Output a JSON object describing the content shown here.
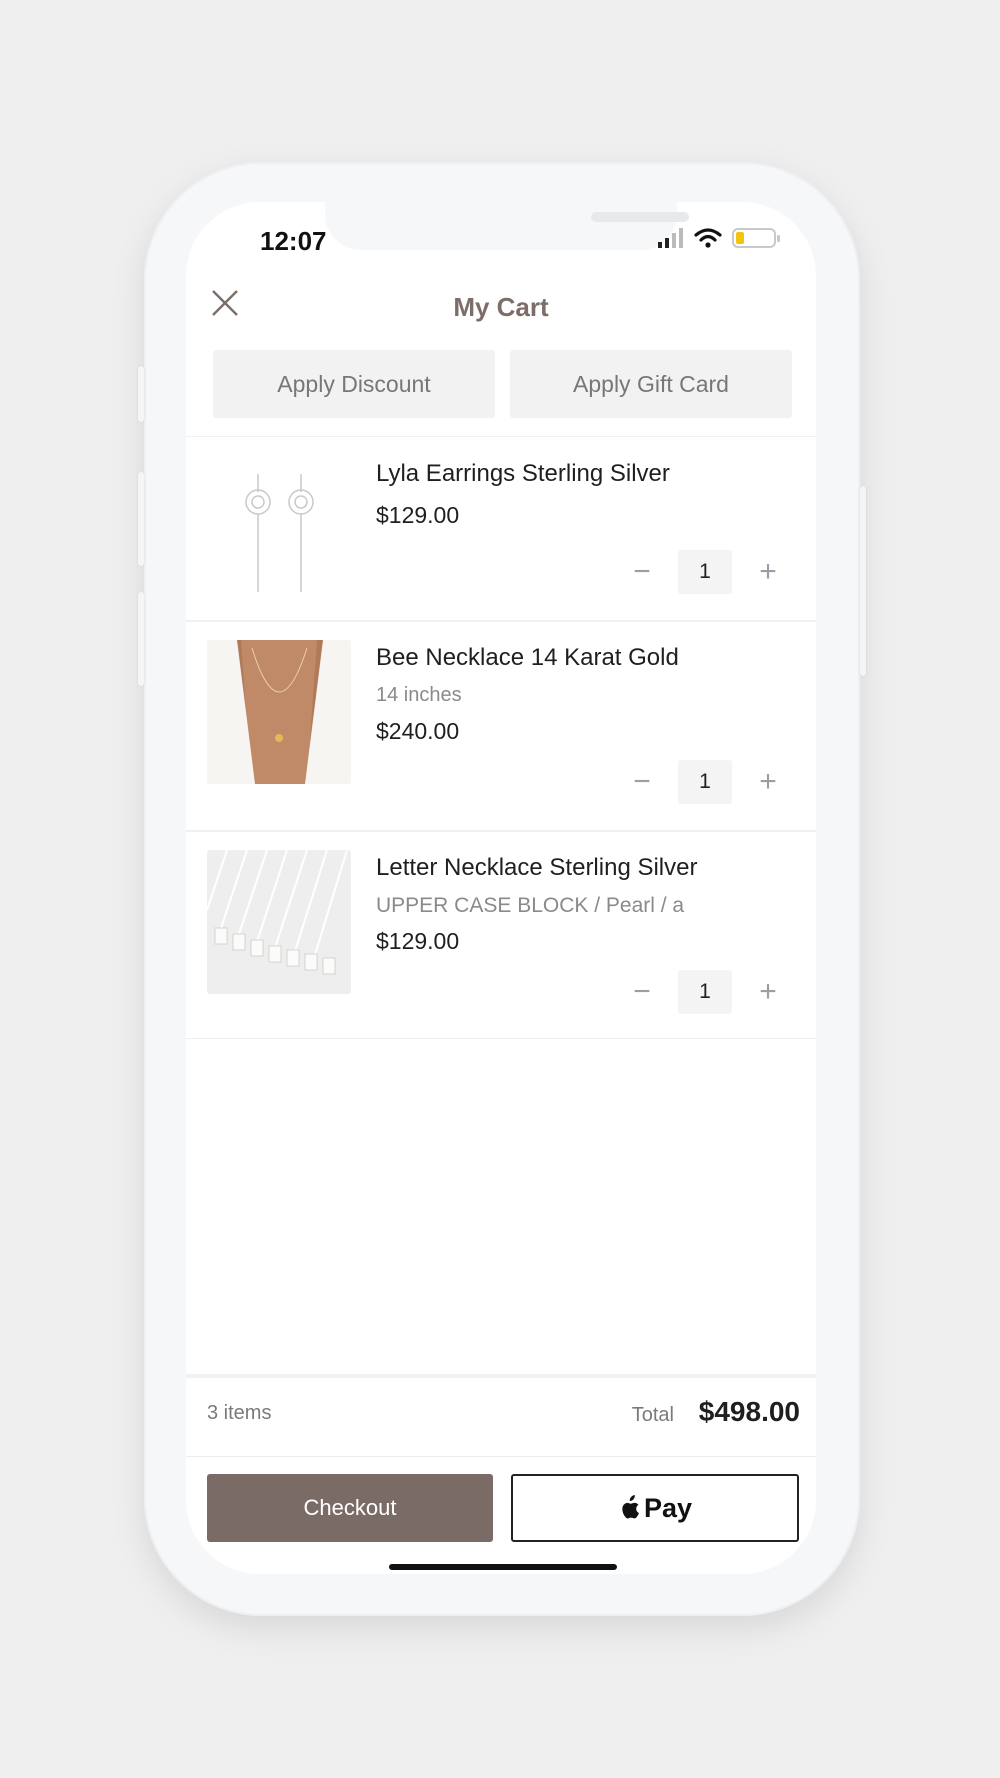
{
  "status_bar": {
    "time": "12:07",
    "icons": [
      "cellular-icon",
      "wifi-icon",
      "battery-icon"
    ]
  },
  "header": {
    "title": "My Cart",
    "close_icon": "close-icon"
  },
  "actions": {
    "apply_discount": "Apply Discount",
    "apply_gift_card": "Apply Gift Card"
  },
  "items": [
    {
      "title": "Lyla Earrings Sterling Silver",
      "variant": "",
      "price": "$129.00",
      "qty": "1",
      "minus": "−",
      "plus": "+"
    },
    {
      "title": "Bee Necklace 14 Karat Gold",
      "variant": "14 inches",
      "price": "$240.00",
      "qty": "1",
      "minus": "−",
      "plus": "+"
    },
    {
      "title": "Letter Necklace Sterling Silver",
      "variant": "UPPER CASE BLOCK / Pearl / a",
      "price": "$129.00",
      "qty": "1",
      "minus": "−",
      "plus": "+"
    }
  ],
  "footer": {
    "count": "3 items",
    "total_label": "Total",
    "total": "$498.00",
    "checkout": "Checkout",
    "apple_pay": "Pay"
  },
  "colors": {
    "accent": "#7b6b67",
    "title": "#7c6d68",
    "background": "#efefef"
  }
}
